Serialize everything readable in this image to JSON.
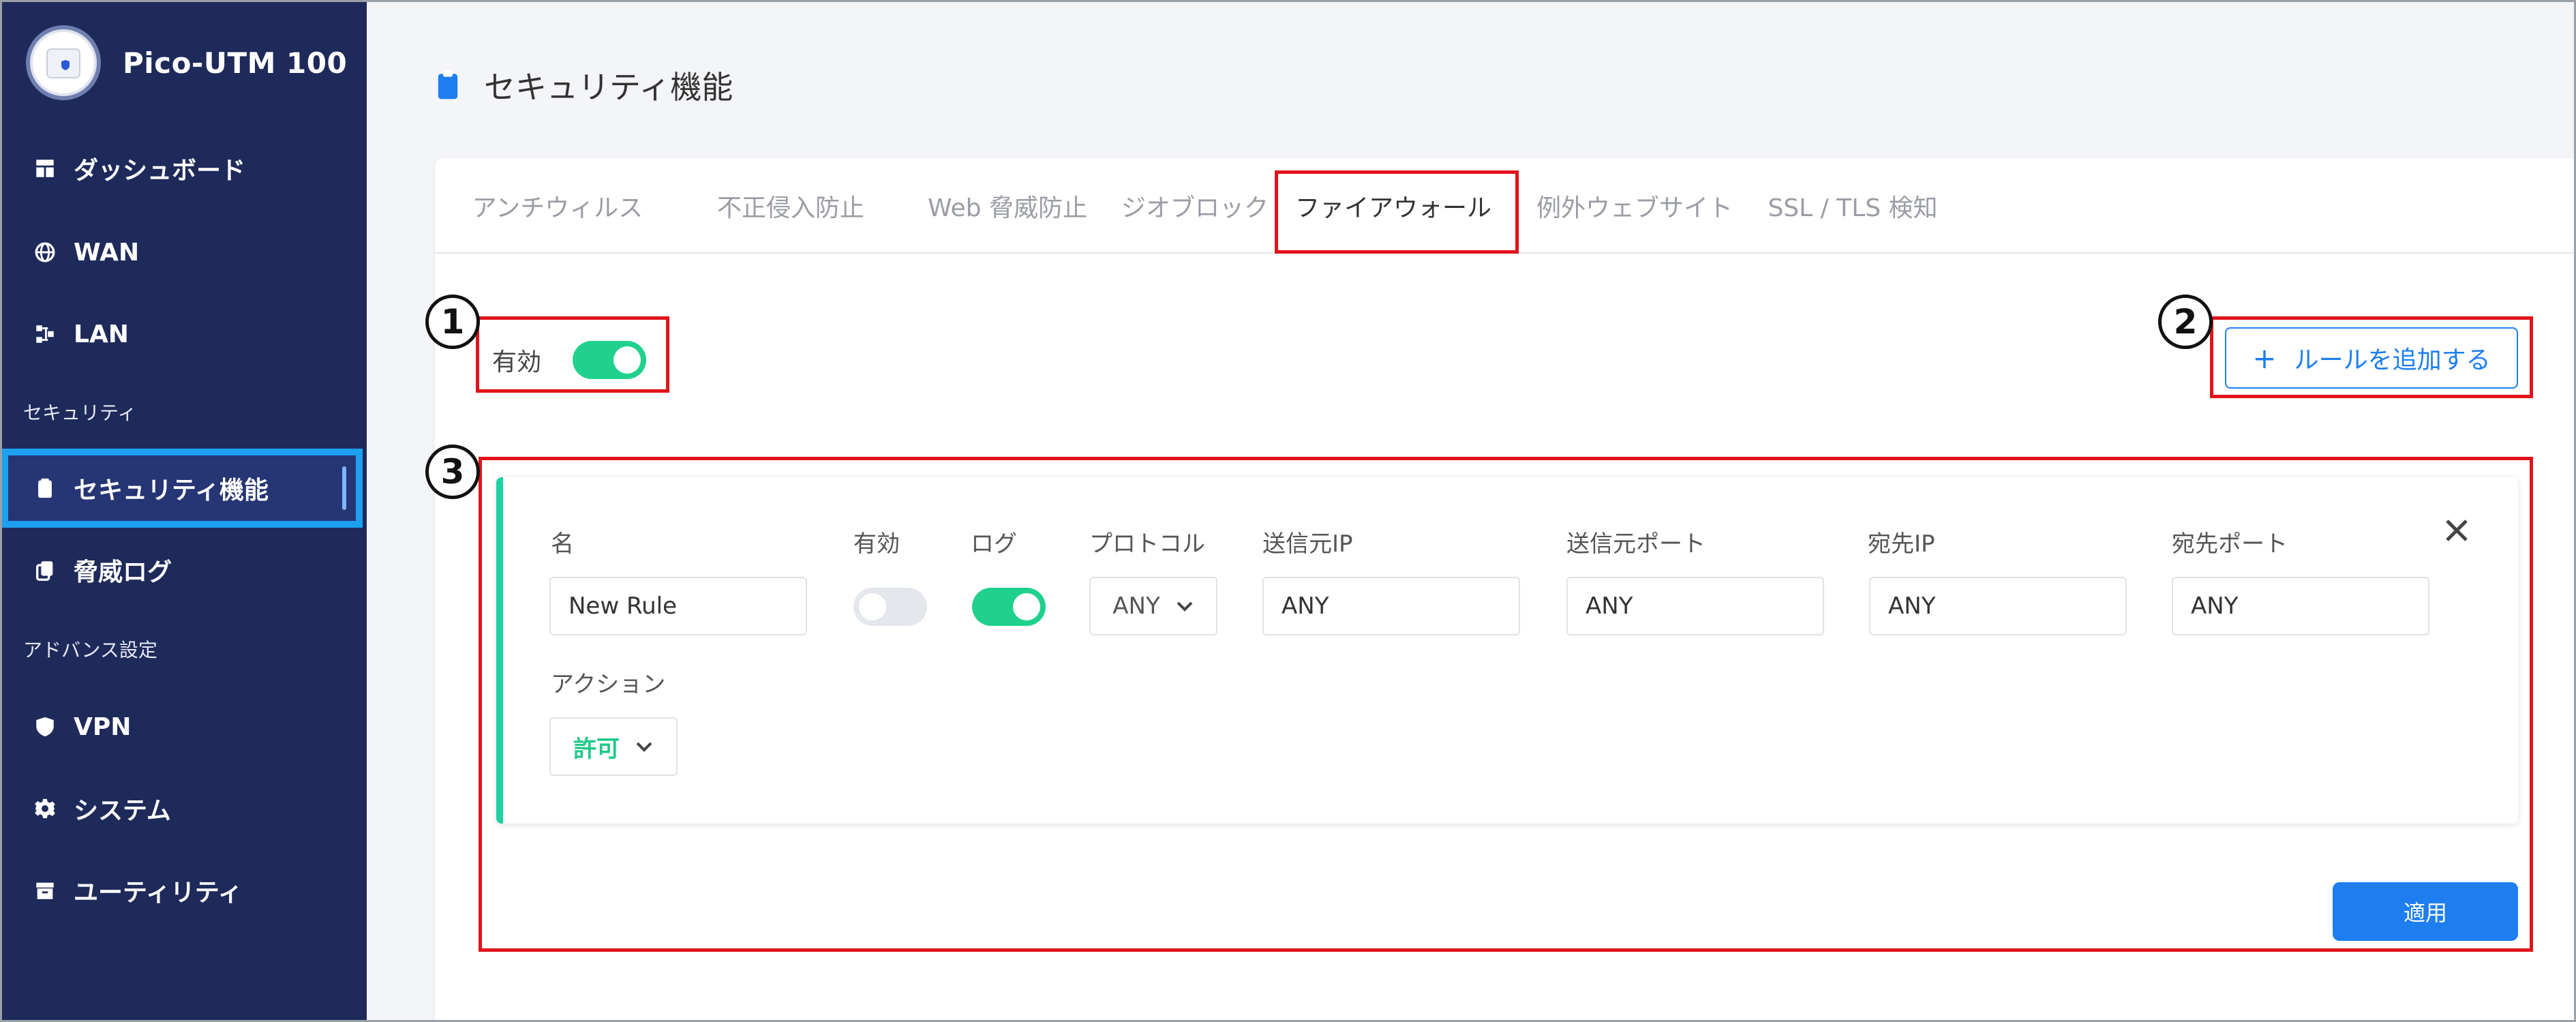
{
  "brand": {
    "title": "Pico-UTM 100"
  },
  "sidebar": {
    "items": [
      {
        "label": "ダッシュボード",
        "icon": "dashboard-icon"
      },
      {
        "label": "WAN",
        "icon": "globe-icon"
      },
      {
        "label": "LAN",
        "icon": "network-icon"
      },
      {
        "label": "セキュリティ機能",
        "icon": "clipboard-icon"
      },
      {
        "label": "脅威ログ",
        "icon": "copy-icon"
      },
      {
        "label": "VPN",
        "icon": "shield-icon"
      },
      {
        "label": "システム",
        "icon": "gear-icon"
      },
      {
        "label": "ユーティリティ",
        "icon": "archive-icon"
      }
    ],
    "sections": {
      "security": "セキュリティ",
      "advanced": "アドバンス設定"
    }
  },
  "page": {
    "title": "セキュリティ機能"
  },
  "tabs": [
    {
      "label": "アンチウィルス"
    },
    {
      "label": "不正侵入防止"
    },
    {
      "label": "Web 脅威防止"
    },
    {
      "label": "ジオブロック"
    },
    {
      "label": "ファイアウォール"
    },
    {
      "label": "例外ウェブサイト"
    },
    {
      "label": "SSL / TLS 検知"
    }
  ],
  "active_tab": "ファイアウォール",
  "firewall": {
    "enabled_label": "有効",
    "enabled": true,
    "add_rule_label": "ルールを追加する",
    "apply_label": "適用"
  },
  "rule": {
    "labels": {
      "name": "名",
      "enabled": "有効",
      "log": "ログ",
      "protocol": "プロトコル",
      "src_ip": "送信元IP",
      "src_port": "送信元ポート",
      "dst_ip": "宛先IP",
      "dst_port": "宛先ポート",
      "action": "アクション"
    },
    "values": {
      "name": "New Rule",
      "enabled": false,
      "log": true,
      "protocol": "ANY",
      "src_ip": "ANY",
      "src_port": "ANY",
      "dst_ip": "ANY",
      "dst_port": "ANY",
      "action": "許可"
    }
  },
  "callouts": [
    "1",
    "2",
    "3"
  ],
  "colors": {
    "sidebar_bg": "#1e2a5a",
    "accent_blue": "#1e7ef0",
    "toggle_on": "#1fd18c",
    "action_green": "#1fc98a",
    "highlight_red": "#e0141a"
  }
}
